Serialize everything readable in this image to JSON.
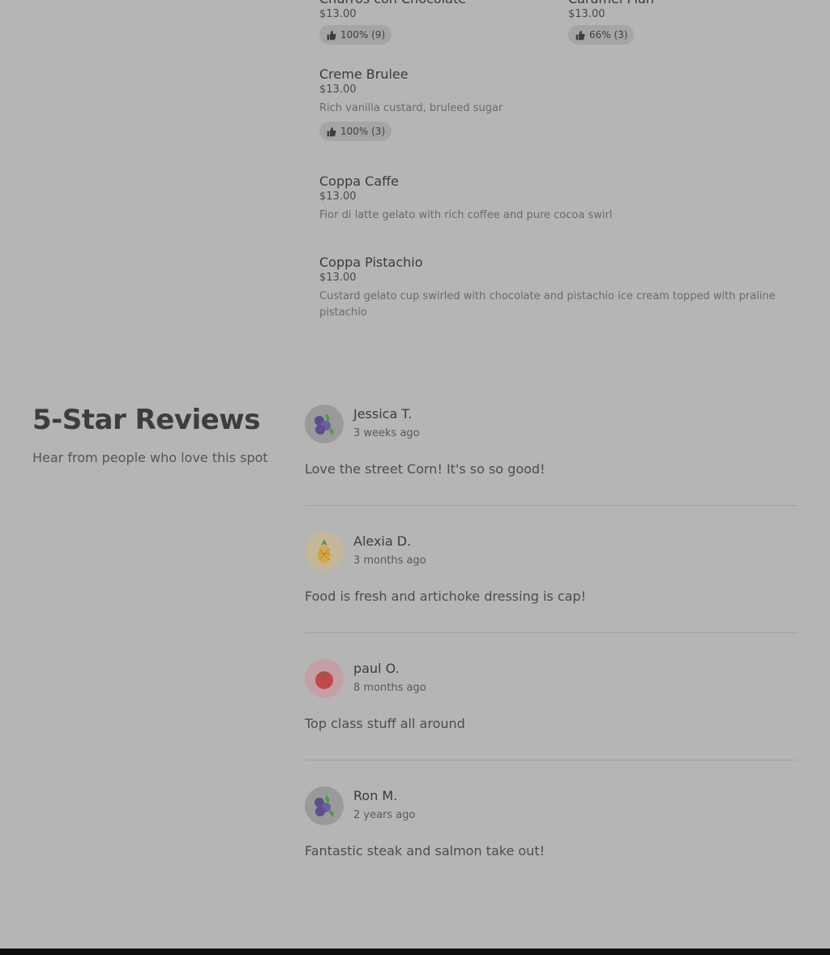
{
  "menu": {
    "items": [
      {
        "name": "Churros con Chocolate",
        "price": "$13.00",
        "rating": "100% (9)"
      },
      {
        "name": "Caramel Flan",
        "price": "$13.00",
        "rating": "66% (3)"
      },
      {
        "name": "Creme Brulee",
        "price": "$13.00",
        "description": "Rich vanilla custard, bruleed sugar",
        "rating": "100% (3)"
      },
      {
        "name": "Coppa Caffe",
        "price": "$13.00",
        "description": "Fior di latte gelato with rich coffee and pure cocoa swirl"
      },
      {
        "name": "Coppa Pistachio",
        "price": "$13.00",
        "description": "Custard gelato cup swirled with chocolate and pistachio ice cream topped with praline pistachio"
      }
    ]
  },
  "reviews": {
    "title": "5-Star Reviews",
    "subtitle": "Hear from people who love this spot",
    "items": [
      {
        "name": "Jessica T.",
        "time": "3 weeks ago",
        "text": "Love the street Corn! It's so so good!",
        "avatar_icon": "blueberry-icon",
        "avatar_bg": "#9a9a9a"
      },
      {
        "name": "Alexia D.",
        "time": "3 months ago",
        "text": "Food is fresh and artichoke dressing is cap!",
        "avatar_icon": "pineapple-icon",
        "avatar_bg": "#c4b79a"
      },
      {
        "name": "paul O.",
        "time": "8 months ago",
        "text": "Top class stuff all around",
        "avatar_icon": "tomato-icon",
        "avatar_bg": "#c4a0a6"
      },
      {
        "name": "Ron M.",
        "time": "2 years ago",
        "text": "Fantastic steak and salmon take out!",
        "avatar_icon": "blueberry-icon",
        "avatar_bg": "#9a9a9a"
      }
    ]
  },
  "colors": {
    "page_background": "#b5b5b5",
    "footer_bar": "#0e0e0e"
  }
}
